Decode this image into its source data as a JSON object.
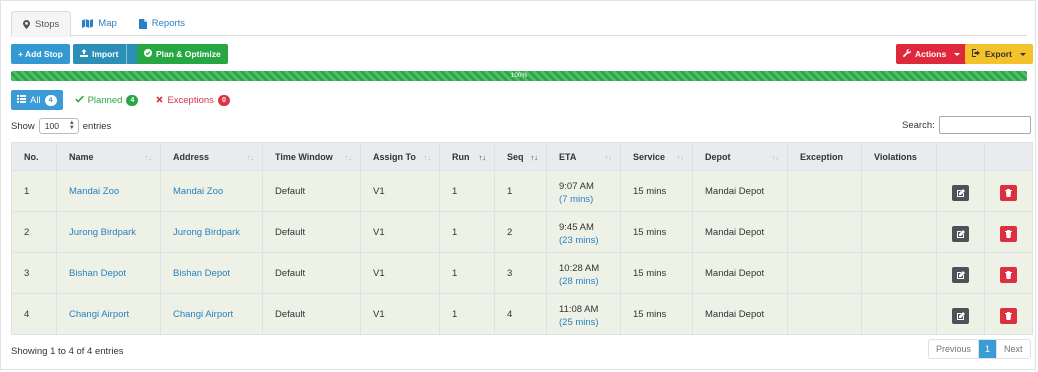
{
  "tabs": [
    {
      "label": "Stops",
      "icon": "map-marker-icon",
      "active": true
    },
    {
      "label": "Map",
      "icon": "map-icon",
      "active": false
    },
    {
      "label": "Reports",
      "icon": "file-icon",
      "active": false
    }
  ],
  "toolbar": {
    "add_stop": "+ Add Stop",
    "import": "Import",
    "plan_optimize": "Plan & Optimize",
    "actions": "Actions",
    "export": "Export"
  },
  "colors": {
    "primary": "#3399d3",
    "success": "#27a744",
    "danger": "#e0283c",
    "warning": "#f4c22a",
    "row_bg": "#eef2e6"
  },
  "progress": {
    "label": "100%",
    "value": 1.0
  },
  "filters": {
    "all": {
      "label": "All",
      "count": "4"
    },
    "planned": {
      "label": "Planned",
      "count": "4"
    },
    "exceptions": {
      "label": "Exceptions",
      "count": "0"
    }
  },
  "length": {
    "show": "Show",
    "value": "100",
    "entries": "entries"
  },
  "search": {
    "label": "Search:"
  },
  "table": {
    "headers": {
      "no": "No.",
      "name": "Name",
      "address": "Address",
      "time_window": "Time Window",
      "assign_to": "Assign To",
      "run": "Run",
      "seq": "Seq",
      "eta": "ETA",
      "service": "Service",
      "depot": "Depot",
      "exception": "Exception",
      "violations": "Violations"
    },
    "rows": [
      {
        "no": "1",
        "name": "Mandai Zoo",
        "address": "Mandai Zoo",
        "time_window": "Default",
        "assign_to": "V1",
        "run": "1",
        "seq": "1",
        "eta": "9:07 AM",
        "eta_delta": "(7 mins)",
        "service": "15 mins",
        "depot": "Mandai Depot",
        "exception": "",
        "violations": ""
      },
      {
        "no": "2",
        "name": "Jurong Birdpark",
        "address": "Jurong Birdpark",
        "time_window": "Default",
        "assign_to": "V1",
        "run": "1",
        "seq": "2",
        "eta": "9:45 AM",
        "eta_delta": "(23 mins)",
        "service": "15 mins",
        "depot": "Mandai Depot",
        "exception": "",
        "violations": ""
      },
      {
        "no": "3",
        "name": "Bishan Depot",
        "address": "Bishan Depot",
        "time_window": "Default",
        "assign_to": "V1",
        "run": "1",
        "seq": "3",
        "eta": "10:28 AM",
        "eta_delta": "(28 mins)",
        "service": "15 mins",
        "depot": "Mandai Depot",
        "exception": "",
        "violations": ""
      },
      {
        "no": "4",
        "name": "Changi Airport",
        "address": "Changi Airport",
        "time_window": "Default",
        "assign_to": "V1",
        "run": "1",
        "seq": "4",
        "eta": "11:08 AM",
        "eta_delta": "(25 mins)",
        "service": "15 mins",
        "depot": "Mandai Depot",
        "exception": "",
        "violations": ""
      }
    ]
  },
  "footer": {
    "info": "Showing 1 to 4 of 4 entries",
    "previous": "Previous",
    "page": "1",
    "next": "Next"
  }
}
